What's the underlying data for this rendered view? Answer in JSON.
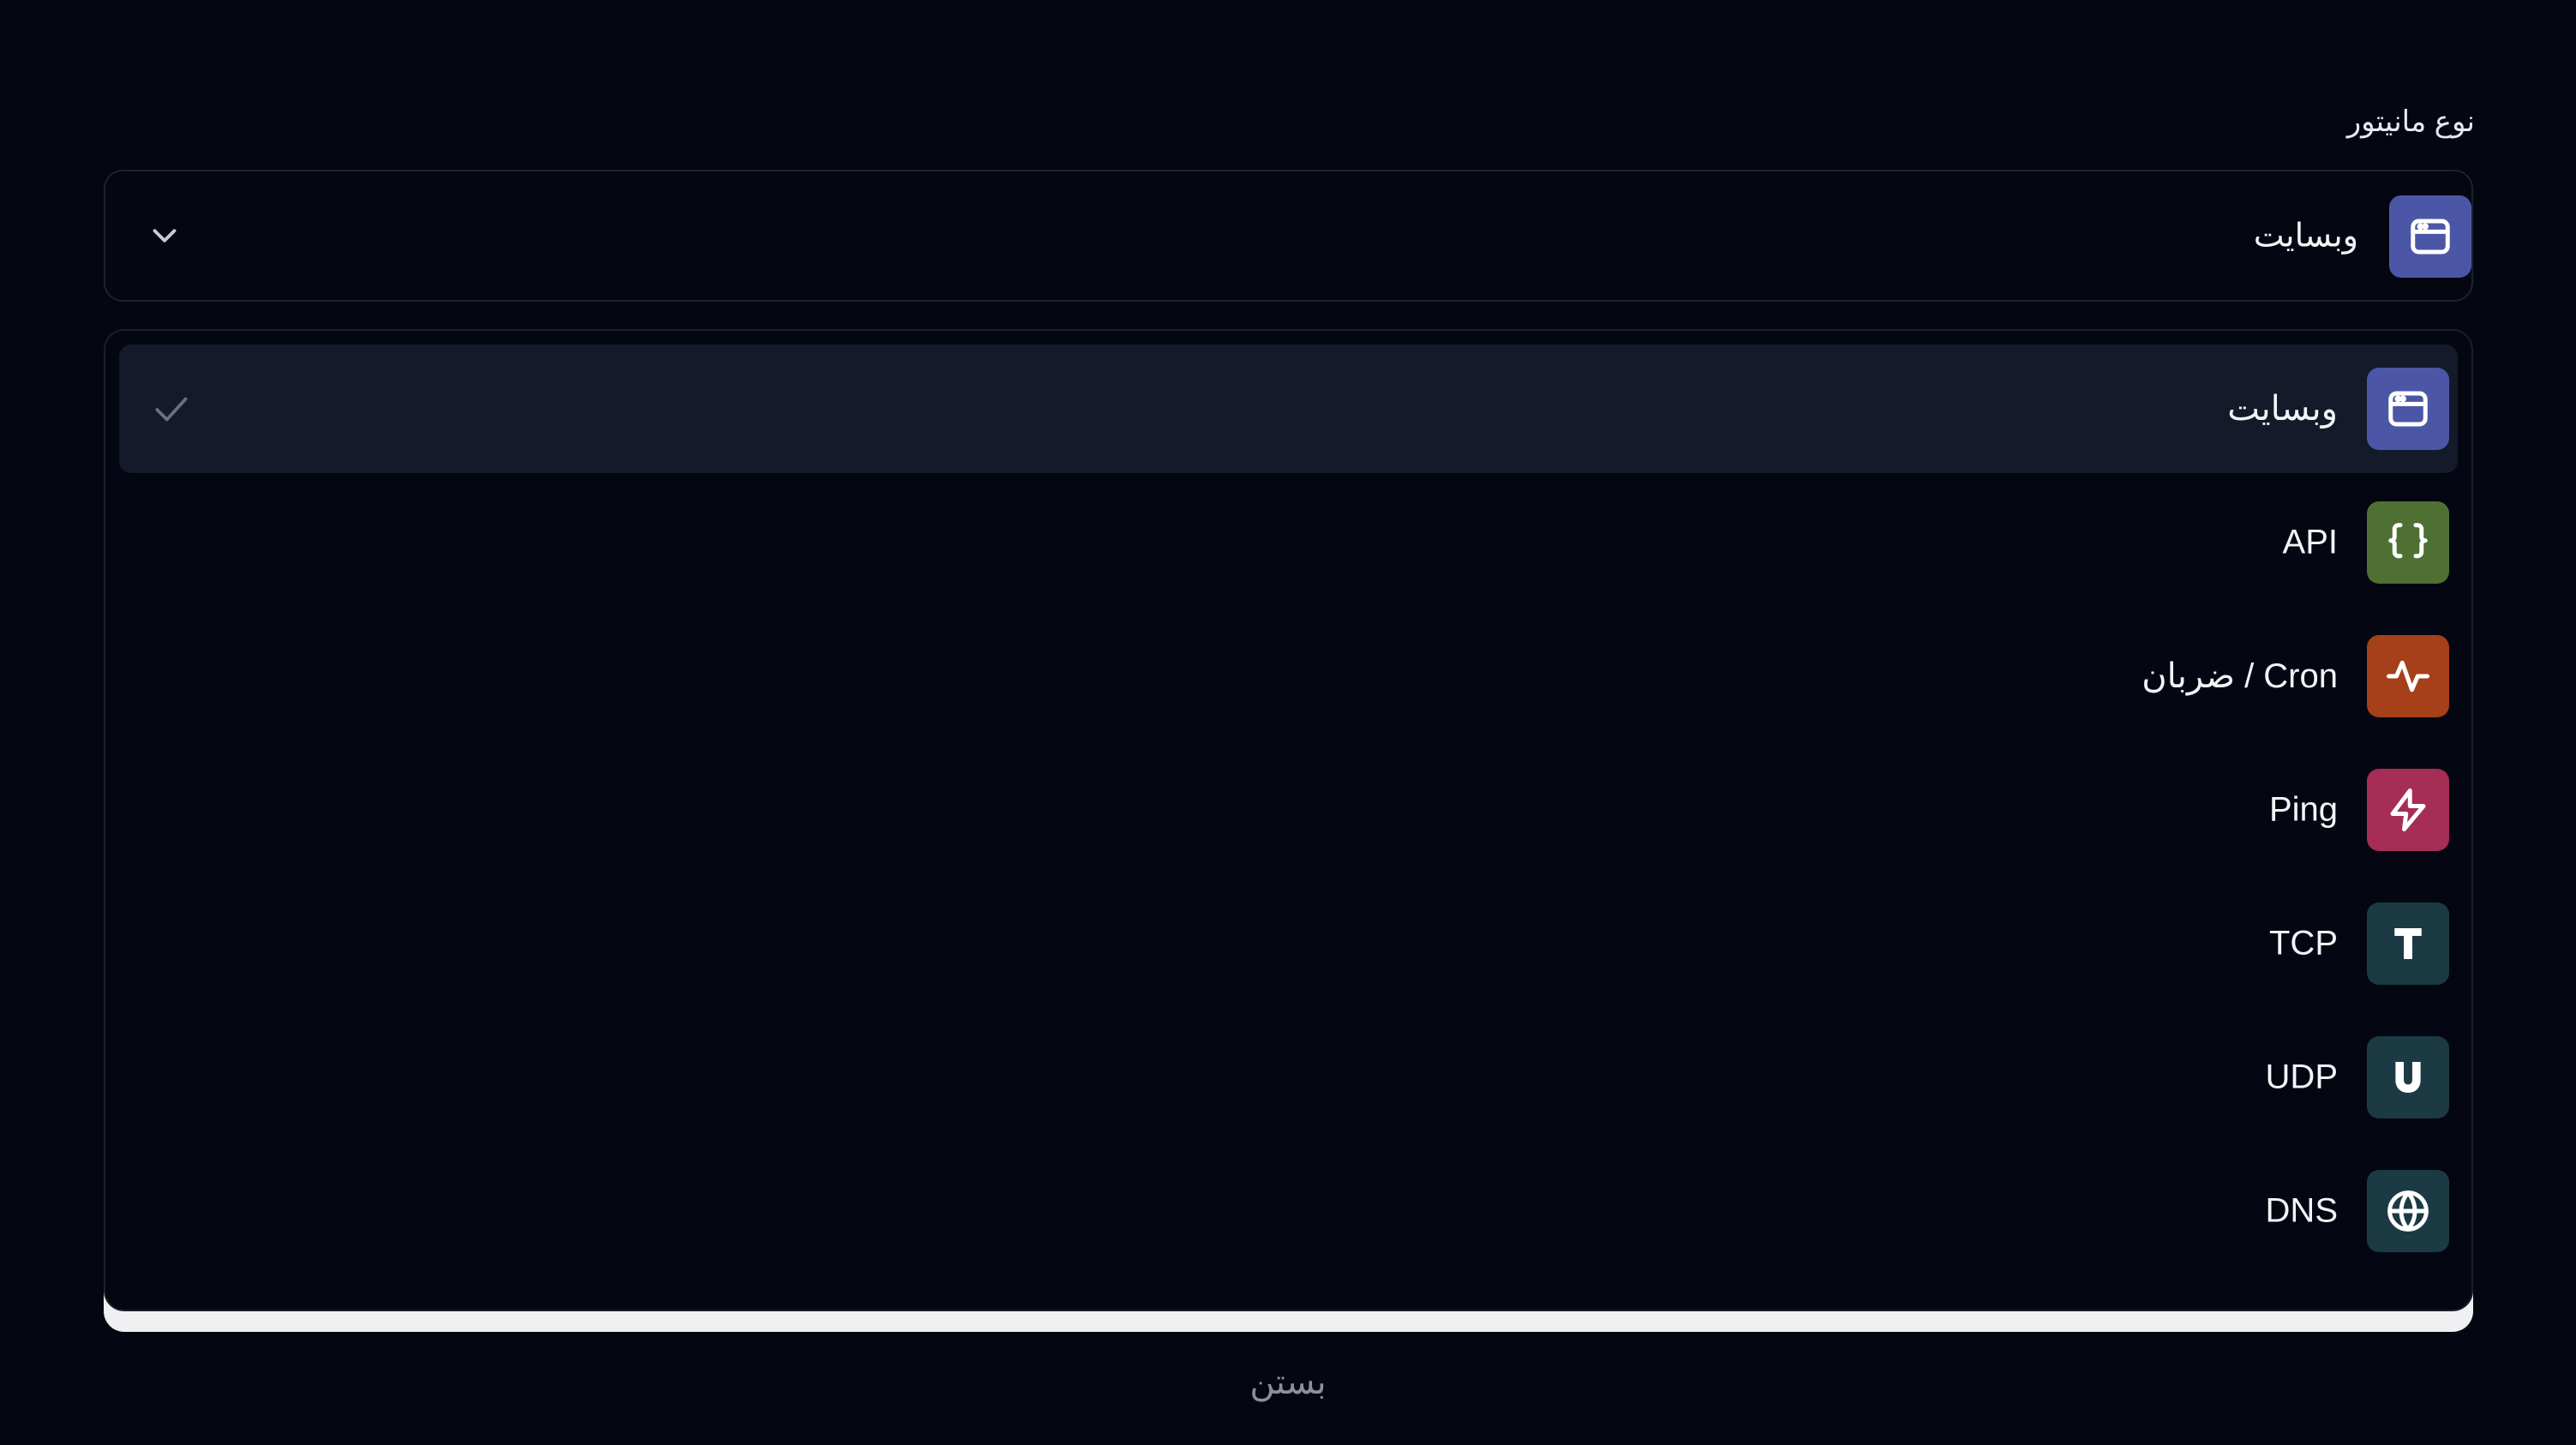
{
  "field": {
    "label": "نوع مانیتور",
    "selected": {
      "label": "وبسایت",
      "icon": "browser-window-icon",
      "color": "#4b57a6"
    }
  },
  "options": [
    {
      "label": "وبسایت",
      "icon": "browser-window-icon",
      "color": "#4b57a6",
      "selected": true
    },
    {
      "label": "API",
      "icon": "braces-icon",
      "color": "#4e7133",
      "selected": false
    },
    {
      "label": "ضربان / Cron",
      "icon": "heartbeat-icon",
      "color": "#a5401a",
      "selected": false
    },
    {
      "label": "Ping",
      "icon": "lightning-icon",
      "color": "#a62d55",
      "selected": false
    },
    {
      "label": "TCP",
      "icon": "letter-t-icon",
      "color": "#1c3a44",
      "selected": false
    },
    {
      "label": "UDP",
      "icon": "letter-u-icon",
      "color": "#1c3a44",
      "selected": false
    },
    {
      "label": "DNS",
      "icon": "globe-icon",
      "color": "#1c3a44",
      "selected": false
    }
  ],
  "footer": {
    "close_label": "بستن"
  }
}
